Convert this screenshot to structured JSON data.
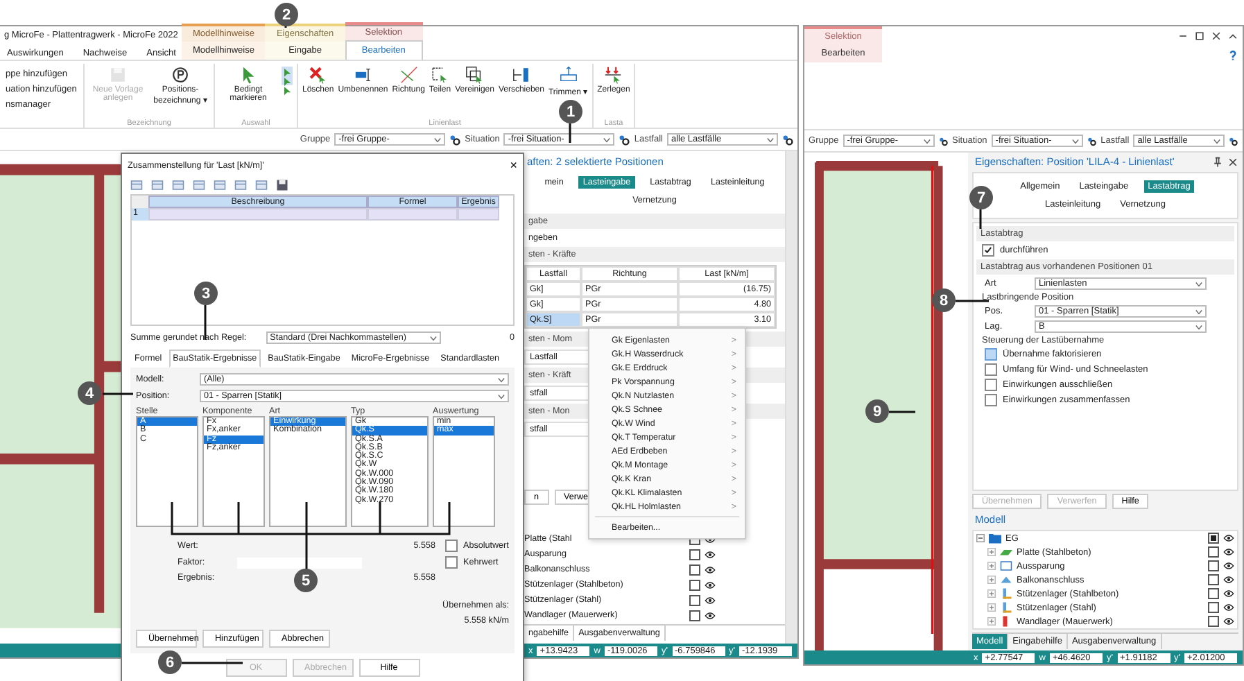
{
  "left": {
    "title": "g MicroFe - Plattentragwerk - MicroFe 2022",
    "context_groups": [
      {
        "label": "Modellhinweise",
        "tab": "Modellhinweise",
        "color": "#e8a050",
        "selected": false
      },
      {
        "label": "Eigenschaften",
        "tab": "Eingabe",
        "color": "#ecd27a",
        "selected": false
      },
      {
        "label": "Selektion",
        "tab": "Bearbeiten",
        "color": "#e88a8a",
        "selected": true
      }
    ],
    "tabs": [
      {
        "label": "Auswirkungen",
        "selected": false
      },
      {
        "label": "Nachweise",
        "selected": false
      },
      {
        "label": "Ansicht",
        "selected": false
      }
    ],
    "ribbon_links": [
      "ppe hinzufügen",
      "uation hinzufügen",
      "nsmanager"
    ],
    "ribbon_groups": [
      {
        "label": "Bezeichnung",
        "buttons": [
          {
            "kind": "save",
            "label": "Neue Vorlage anlegen",
            "disabled": true
          },
          {
            "kind": "pcircle",
            "label": "Positions-bezeichnung ▾",
            "disabled": false
          }
        ]
      },
      {
        "label": "Auswahl",
        "buttons": [
          {
            "kind": "cursor",
            "label": "Bedingt markieren",
            "disabled": false
          },
          {
            "kind": "smallcursors",
            "disabled": false
          }
        ]
      },
      {
        "label": "Linienlast",
        "buttons": [
          {
            "kind": "delete",
            "label": "Löschen",
            "disabled": false
          },
          {
            "kind": "rename",
            "label": "Umbenennen",
            "disabled": false
          },
          {
            "kind": "direction",
            "label": "Richtung",
            "disabled": false
          },
          {
            "kind": "split",
            "label": "Teilen",
            "disabled": false
          },
          {
            "kind": "merge",
            "label": "Vereinigen",
            "disabled": false
          },
          {
            "kind": "move",
            "label": "Verschieben",
            "disabled": false
          },
          {
            "kind": "trim",
            "label": "Trimmen ▾",
            "disabled": false
          }
        ]
      },
      {
        "label": "Lasta",
        "buttons": [
          {
            "kind": "decompose",
            "label": "Zerlegen",
            "disabled": false
          }
        ]
      }
    ],
    "filters": [
      {
        "label": "Gruppe",
        "value": "-frei Gruppe-"
      },
      {
        "label": "Situation",
        "value": "-frei Situation-"
      },
      {
        "label": "Lastfall",
        "value": "alle Lastfälle"
      }
    ],
    "properties": {
      "title": "aften: 2 selektierte Positionen",
      "tabs": [
        {
          "label": "mein",
          "selected": false
        },
        {
          "label": "Lasteingabe",
          "selected": true
        },
        {
          "label": "Lastabtrag",
          "selected": false
        },
        {
          "label": "Lasteinleitung",
          "selected": false
        },
        {
          "label": "Vernetzung",
          "selected": false
        }
      ],
      "section": "gabe",
      "row": "ngeben",
      "forces_header": "sten - Kräfte",
      "columns": [
        "Lastfall",
        "Richtung",
        "Last [kN/m]"
      ],
      "rows": [
        {
          "cells": [
            "Gk]",
            "PGr",
            "(16.75)"
          ],
          "selected": false
        },
        {
          "cells": [
            "Gk]",
            "PGr",
            "4.80"
          ],
          "selected": false
        },
        {
          "cells": [
            "Qk.S]",
            "PGr",
            "3.10"
          ],
          "selected": true
        }
      ],
      "more_sections": [
        {
          "header": "sten - Mom",
          "cells": [
            "Lastfall"
          ]
        },
        {
          "header": "sten - Kräft",
          "cells": [
            "stfall"
          ]
        },
        {
          "header": "sten - Mon",
          "cells": [
            "stfall"
          ]
        }
      ],
      "buttons": [
        "n",
        "Verwe"
      ]
    },
    "model_items": [
      {
        "label": "Platte (Stahl",
        "checked": false
      },
      {
        "label": "Ausparung",
        "checked": false
      },
      {
        "label": "Balkonanschluss",
        "checked": false
      },
      {
        "label": "Stützenlager (Stahlbeton)",
        "checked": false
      },
      {
        "label": "Stützenlager (Stahl)",
        "checked": false
      },
      {
        "label": "Wandlager (Mauerwerk)",
        "checked": false
      }
    ],
    "bottom_tabs": [
      "ngabehilfe",
      "Ausgabenverwaltung"
    ],
    "status": [
      {
        "label": "x",
        "value": "+13.9423"
      },
      {
        "label": "w",
        "value": "-119.0026"
      },
      {
        "label": "y'",
        "value": "-6.759846"
      },
      {
        "label": "y'",
        "value": "-12.1939"
      }
    ]
  },
  "context_menu": {
    "items": [
      {
        "label": "Gk  Eigenlasten",
        "submenu": true
      },
      {
        "label": "Gk.H  Wasserdruck",
        "submenu": true
      },
      {
        "label": "Gk.E  Erddruck",
        "submenu": true
      },
      {
        "label": "Pk  Vorspannung",
        "submenu": true
      },
      {
        "label": "Qk.N  Nutzlasten",
        "submenu": true
      },
      {
        "label": "Qk.S  Schnee",
        "submenu": true
      },
      {
        "label": "Qk.W  Wind",
        "submenu": true
      },
      {
        "label": "Qk.T  Temperatur",
        "submenu": true
      },
      {
        "label": "AEd  Erdbeben",
        "submenu": true
      },
      {
        "label": "Qk.M  Montage",
        "submenu": true
      },
      {
        "label": "Qk.K  Kran",
        "submenu": true
      },
      {
        "label": "Qk.KL  Klimalasten",
        "submenu": true
      },
      {
        "label": "Qk.HL  Holmlasten",
        "submenu": true
      },
      {
        "label": "Bearbeiten...",
        "submenu": false
      }
    ],
    "arrow": ">"
  },
  "dialog": {
    "title": "Zusammenstellung für 'Last [kN/m]'",
    "close": "×",
    "columns": [
      "Beschreibung",
      "Formel",
      "Ergebnis"
    ],
    "row_number": "1",
    "sum_label": "Summe gerundet nach Regel:",
    "sum_rule": "Standard (Drei Nachkommastellen)",
    "sum_value": "0",
    "tabs": [
      {
        "label": "Formel",
        "selected": false
      },
      {
        "label": "BauStatik-Ergebnisse",
        "selected": true
      },
      {
        "label": "BauStatik-Eingabe",
        "selected": false
      },
      {
        "label": "MicroFe-Ergebnisse",
        "selected": false
      },
      {
        "label": "Standardlasten",
        "selected": false
      }
    ],
    "fields": [
      {
        "label": "Modell:",
        "value": "(Alle)"
      },
      {
        "label": "Position:",
        "value": "01 - Sparren [Statik]"
      }
    ],
    "lists": [
      {
        "label": "Stelle",
        "items": [
          {
            "text": "A",
            "selected": true
          },
          {
            "text": "B",
            "selected": false
          },
          {
            "text": "C",
            "selected": false
          }
        ]
      },
      {
        "label": "Komponente",
        "items": [
          {
            "text": "Fx",
            "selected": false
          },
          {
            "text": "Fx,anker",
            "selected": false
          },
          {
            "text": "Fz",
            "selected": true
          },
          {
            "text": "Fz,anker",
            "selected": false
          }
        ]
      },
      {
        "label": "Art",
        "items": [
          {
            "text": "Einwirkung",
            "selected": true
          },
          {
            "text": "Kombination",
            "selected": false
          }
        ]
      },
      {
        "label": "Typ",
        "items": [
          {
            "text": "Gk",
            "selected": false
          },
          {
            "text": "Qk.S",
            "selected": true
          },
          {
            "text": "Qk.S.A",
            "selected": false
          },
          {
            "text": "Qk.S.B",
            "selected": false
          },
          {
            "text": "Qk.S.C",
            "selected": false
          },
          {
            "text": "Qk.W",
            "selected": false
          },
          {
            "text": "Qk.W.000",
            "selected": false
          },
          {
            "text": "Qk.W.090",
            "selected": false
          },
          {
            "text": "Qk.W.180",
            "selected": false
          },
          {
            "text": "Qk.W.270",
            "selected": false
          }
        ]
      },
      {
        "label": "Auswertung",
        "items": [
          {
            "text": "min",
            "selected": false
          },
          {
            "text": "max",
            "selected": true
          }
        ]
      }
    ],
    "wert_label": "Wert:",
    "wert": "5.558",
    "abs": {
      "label": "Absolutwert",
      "checked": false
    },
    "faktor_label": "Faktor:",
    "kehr": {
      "label": "Kehrwert",
      "checked": false
    },
    "ergebnis_label": "Ergebnis:",
    "ergebnis": "5.558",
    "uebernehmen_als": "Übernehmen als:",
    "result": "5.558 kN/m",
    "actions": [
      "Übernehmen",
      "Hinzufügen",
      "Abbrechen"
    ],
    "footer": [
      {
        "label": "OK",
        "disabled": true
      },
      {
        "label": "Abbrechen",
        "disabled": true
      },
      {
        "label": "Hilfe",
        "disabled": false
      }
    ]
  },
  "right": {
    "context_group": {
      "label": "Selektion",
      "tab": "Bearbeiten",
      "color": "#e88a8a",
      "selected": true
    },
    "filters": [
      {
        "label": "Gruppe",
        "value": "-frei Gruppe-"
      },
      {
        "label": "Situation",
        "value": "-frei Situation-"
      },
      {
        "label": "Lastfall",
        "value": "alle Lastfälle"
      }
    ],
    "properties": {
      "title": "Eigenschaften: Position 'LILA-4 - Linienlast'",
      "tabs": [
        {
          "label": "Allgemein",
          "selected": false
        },
        {
          "label": "Lasteingabe",
          "selected": false
        },
        {
          "label": "Lastabtrag",
          "selected": true
        },
        {
          "label": "Lasteinleitung",
          "selected": false
        },
        {
          "label": "Vernetzung",
          "selected": false
        }
      ],
      "section": "Lastabtrag",
      "perform": {
        "label": "durchführen",
        "checked": true
      },
      "sub_section": "Lastabtrag aus vorhandenen Positionen 01",
      "art": {
        "label": "Art",
        "value": "Linienlasten"
      },
      "source_heading": "Lastbringende Position",
      "fields": [
        {
          "label": "Pos.",
          "value": "01 - Sparren [Statik]"
        },
        {
          "label": "Lag.",
          "value": "B"
        }
      ],
      "control_heading": "Steuerung der Lastübernahme",
      "options": [
        {
          "label": "Übernahme faktorisieren",
          "checked": false,
          "selected": true
        },
        {
          "label": "Umfang für Wind- und Schneelasten",
          "checked": false,
          "selected": false
        },
        {
          "label": "Einwirkungen ausschließen",
          "checked": false,
          "selected": false
        },
        {
          "label": "Einwirkungen zusammenfassen",
          "checked": false,
          "selected": false
        }
      ],
      "buttons": [
        {
          "label": "Übernehmen",
          "disabled": true
        },
        {
          "label": "Verwerfen",
          "disabled": true
        },
        {
          "label": "Hilfe",
          "disabled": false
        }
      ]
    },
    "model": {
      "title": "Modell",
      "root": {
        "label": "EG",
        "expanded": true,
        "checked": true,
        "children": [
          {
            "label": "Platte (Stahlbeton)",
            "kind": "slab",
            "checked": false
          },
          {
            "label": "Aussparung",
            "kind": "opening",
            "checked": false
          },
          {
            "label": "Balkonanschluss",
            "kind": "balcony",
            "checked": false
          },
          {
            "label": "Stützenlager (Stahlbeton)",
            "kind": "column",
            "checked": false
          },
          {
            "label": "Stützenlager (Stahl)",
            "kind": "column",
            "checked": false
          },
          {
            "label": "Wandlager (Mauerwerk)",
            "kind": "wall",
            "checked": false
          }
        ]
      }
    },
    "bottom_tabs": [
      {
        "label": "Modell",
        "selected": true
      },
      {
        "label": "Eingabehilfe",
        "selected": false
      },
      {
        "label": "Ausgabenverwaltung",
        "selected": false
      }
    ],
    "status": [
      {
        "label": "x",
        "value": "+2.77547"
      },
      {
        "label": "w",
        "value": "+46.4620"
      },
      {
        "label": "y'",
        "value": "+1.91182"
      },
      {
        "label": "y'",
        "value": "+2.01200"
      }
    ]
  },
  "callouts": [
    "1",
    "2",
    "3",
    "4",
    "5",
    "6",
    "7",
    "8",
    "9"
  ]
}
